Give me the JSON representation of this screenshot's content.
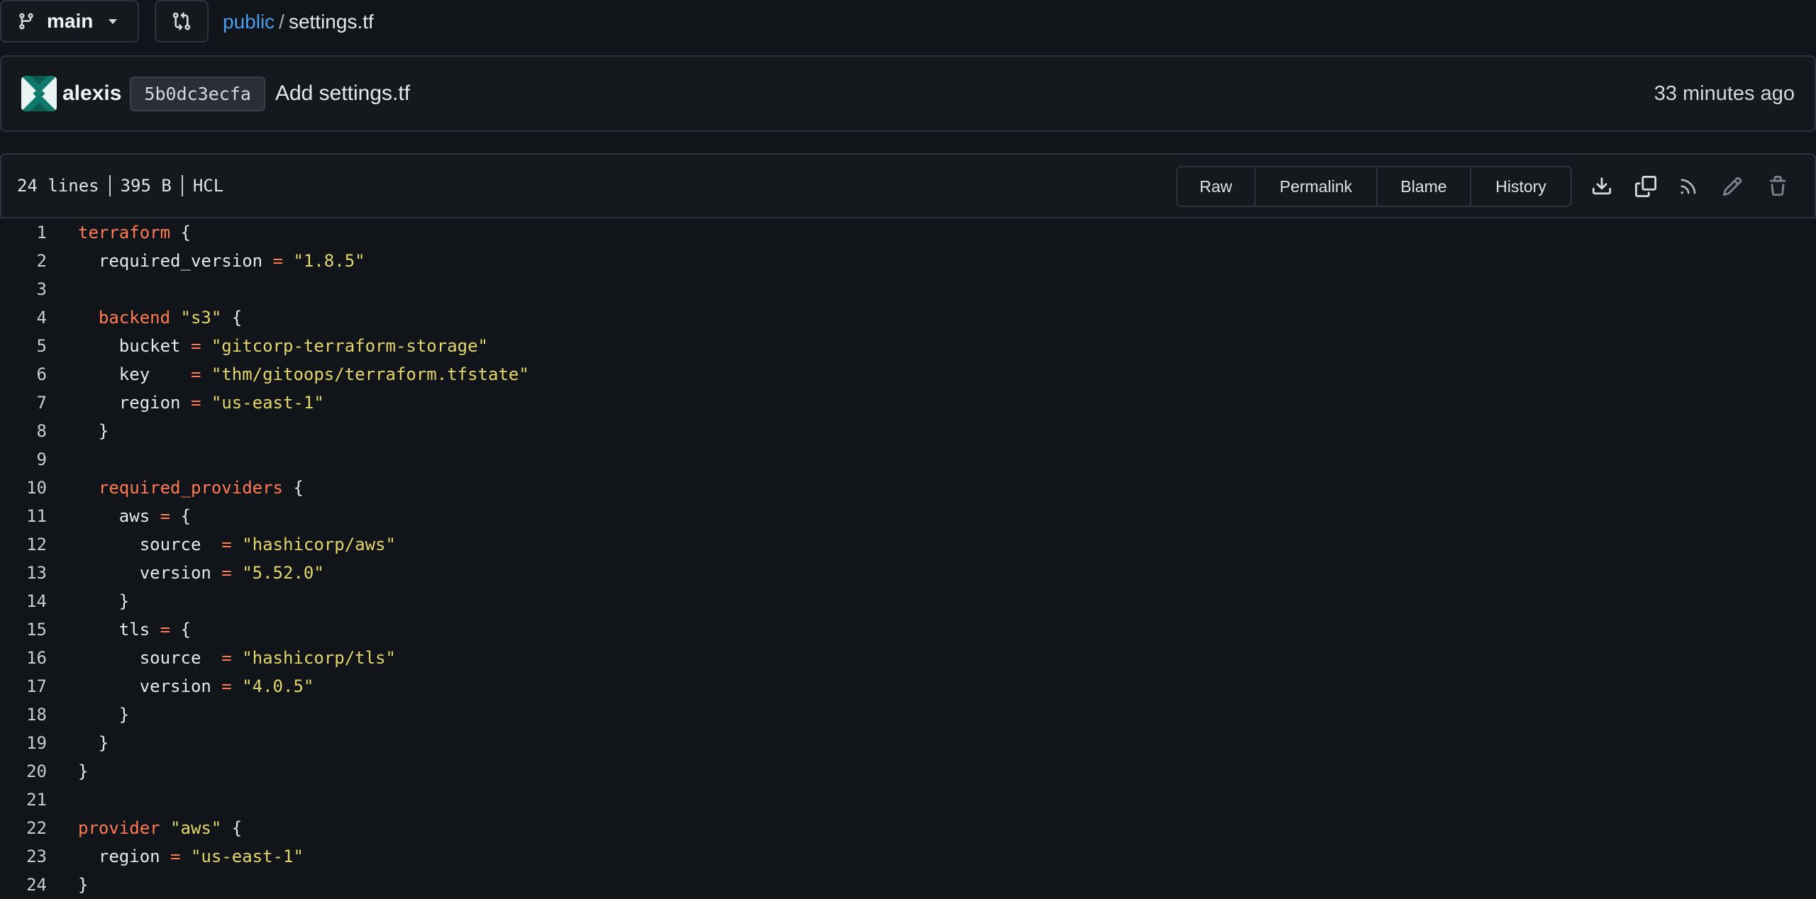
{
  "branch": {
    "name": "main"
  },
  "breadcrumb": {
    "repo": "public",
    "separator": "/",
    "file": "settings.tf"
  },
  "commit": {
    "author": "alexis",
    "sha": "5b0dc3ecfa",
    "message": "Add settings.tf",
    "time": "33 minutes ago"
  },
  "file": {
    "lines": "24 lines",
    "size": "395 B",
    "language": "HCL"
  },
  "actions": {
    "raw": "Raw",
    "permalink": "Permalink",
    "blame": "Blame",
    "history": "History"
  },
  "icons": {
    "branch": "git-branch-icon",
    "pull_request": "git-compare-icon",
    "download": "download-icon",
    "copy": "copy-icon",
    "rss": "rss-icon",
    "edit": "pencil-icon",
    "delete": "trash-icon"
  },
  "colors": {
    "keyword": "#ff7b54",
    "string": "#e2d66c",
    "link": "#4a9eed",
    "background": "#111418"
  },
  "code": [
    {
      "n": "1",
      "tokens": [
        [
          "kw",
          "terraform"
        ],
        [
          "pl",
          " {"
        ]
      ]
    },
    {
      "n": "2",
      "tokens": [
        [
          "pl",
          "  required_version "
        ],
        [
          "op",
          "="
        ],
        [
          "pl",
          " "
        ],
        [
          "str",
          "\"1.8.5\""
        ]
      ]
    },
    {
      "n": "3",
      "tokens": []
    },
    {
      "n": "4",
      "tokens": [
        [
          "pl",
          "  "
        ],
        [
          "kw",
          "backend"
        ],
        [
          "pl",
          " "
        ],
        [
          "str",
          "\"s3\""
        ],
        [
          "pl",
          " {"
        ]
      ]
    },
    {
      "n": "5",
      "tokens": [
        [
          "pl",
          "    bucket "
        ],
        [
          "op",
          "="
        ],
        [
          "pl",
          " "
        ],
        [
          "str",
          "\"gitcorp-terraform-storage\""
        ]
      ]
    },
    {
      "n": "6",
      "tokens": [
        [
          "pl",
          "    key    "
        ],
        [
          "op",
          "="
        ],
        [
          "pl",
          " "
        ],
        [
          "str",
          "\"thm/gitoops/terraform.tfstate\""
        ]
      ]
    },
    {
      "n": "7",
      "tokens": [
        [
          "pl",
          "    region "
        ],
        [
          "op",
          "="
        ],
        [
          "pl",
          " "
        ],
        [
          "str",
          "\"us-east-1\""
        ]
      ]
    },
    {
      "n": "8",
      "tokens": [
        [
          "pl",
          "  }"
        ]
      ]
    },
    {
      "n": "9",
      "tokens": []
    },
    {
      "n": "10",
      "tokens": [
        [
          "pl",
          "  "
        ],
        [
          "kw",
          "required_providers"
        ],
        [
          "pl",
          " {"
        ]
      ]
    },
    {
      "n": "11",
      "tokens": [
        [
          "pl",
          "    aws "
        ],
        [
          "op",
          "="
        ],
        [
          "pl",
          " {"
        ]
      ]
    },
    {
      "n": "12",
      "tokens": [
        [
          "pl",
          "      source  "
        ],
        [
          "op",
          "="
        ],
        [
          "pl",
          " "
        ],
        [
          "str",
          "\"hashicorp/aws\""
        ]
      ]
    },
    {
      "n": "13",
      "tokens": [
        [
          "pl",
          "      version "
        ],
        [
          "op",
          "="
        ],
        [
          "pl",
          " "
        ],
        [
          "str",
          "\"5.52.0\""
        ]
      ]
    },
    {
      "n": "14",
      "tokens": [
        [
          "pl",
          "    }"
        ]
      ]
    },
    {
      "n": "15",
      "tokens": [
        [
          "pl",
          "    tls "
        ],
        [
          "op",
          "="
        ],
        [
          "pl",
          " {"
        ]
      ]
    },
    {
      "n": "16",
      "tokens": [
        [
          "pl",
          "      source  "
        ],
        [
          "op",
          "="
        ],
        [
          "pl",
          " "
        ],
        [
          "str",
          "\"hashicorp/tls\""
        ]
      ]
    },
    {
      "n": "17",
      "tokens": [
        [
          "pl",
          "      version "
        ],
        [
          "op",
          "="
        ],
        [
          "pl",
          " "
        ],
        [
          "str",
          "\"4.0.5\""
        ]
      ]
    },
    {
      "n": "18",
      "tokens": [
        [
          "pl",
          "    }"
        ]
      ]
    },
    {
      "n": "19",
      "tokens": [
        [
          "pl",
          "  }"
        ]
      ]
    },
    {
      "n": "20",
      "tokens": [
        [
          "pl",
          "}"
        ]
      ]
    },
    {
      "n": "21",
      "tokens": []
    },
    {
      "n": "22",
      "tokens": [
        [
          "kw",
          "provider"
        ],
        [
          "pl",
          " "
        ],
        [
          "str",
          "\"aws\""
        ],
        [
          "pl",
          " {"
        ]
      ]
    },
    {
      "n": "23",
      "tokens": [
        [
          "pl",
          "  region "
        ],
        [
          "op",
          "="
        ],
        [
          "pl",
          " "
        ],
        [
          "str",
          "\"us-east-1\""
        ]
      ]
    },
    {
      "n": "24",
      "tokens": [
        [
          "pl",
          "}"
        ]
      ]
    }
  ]
}
